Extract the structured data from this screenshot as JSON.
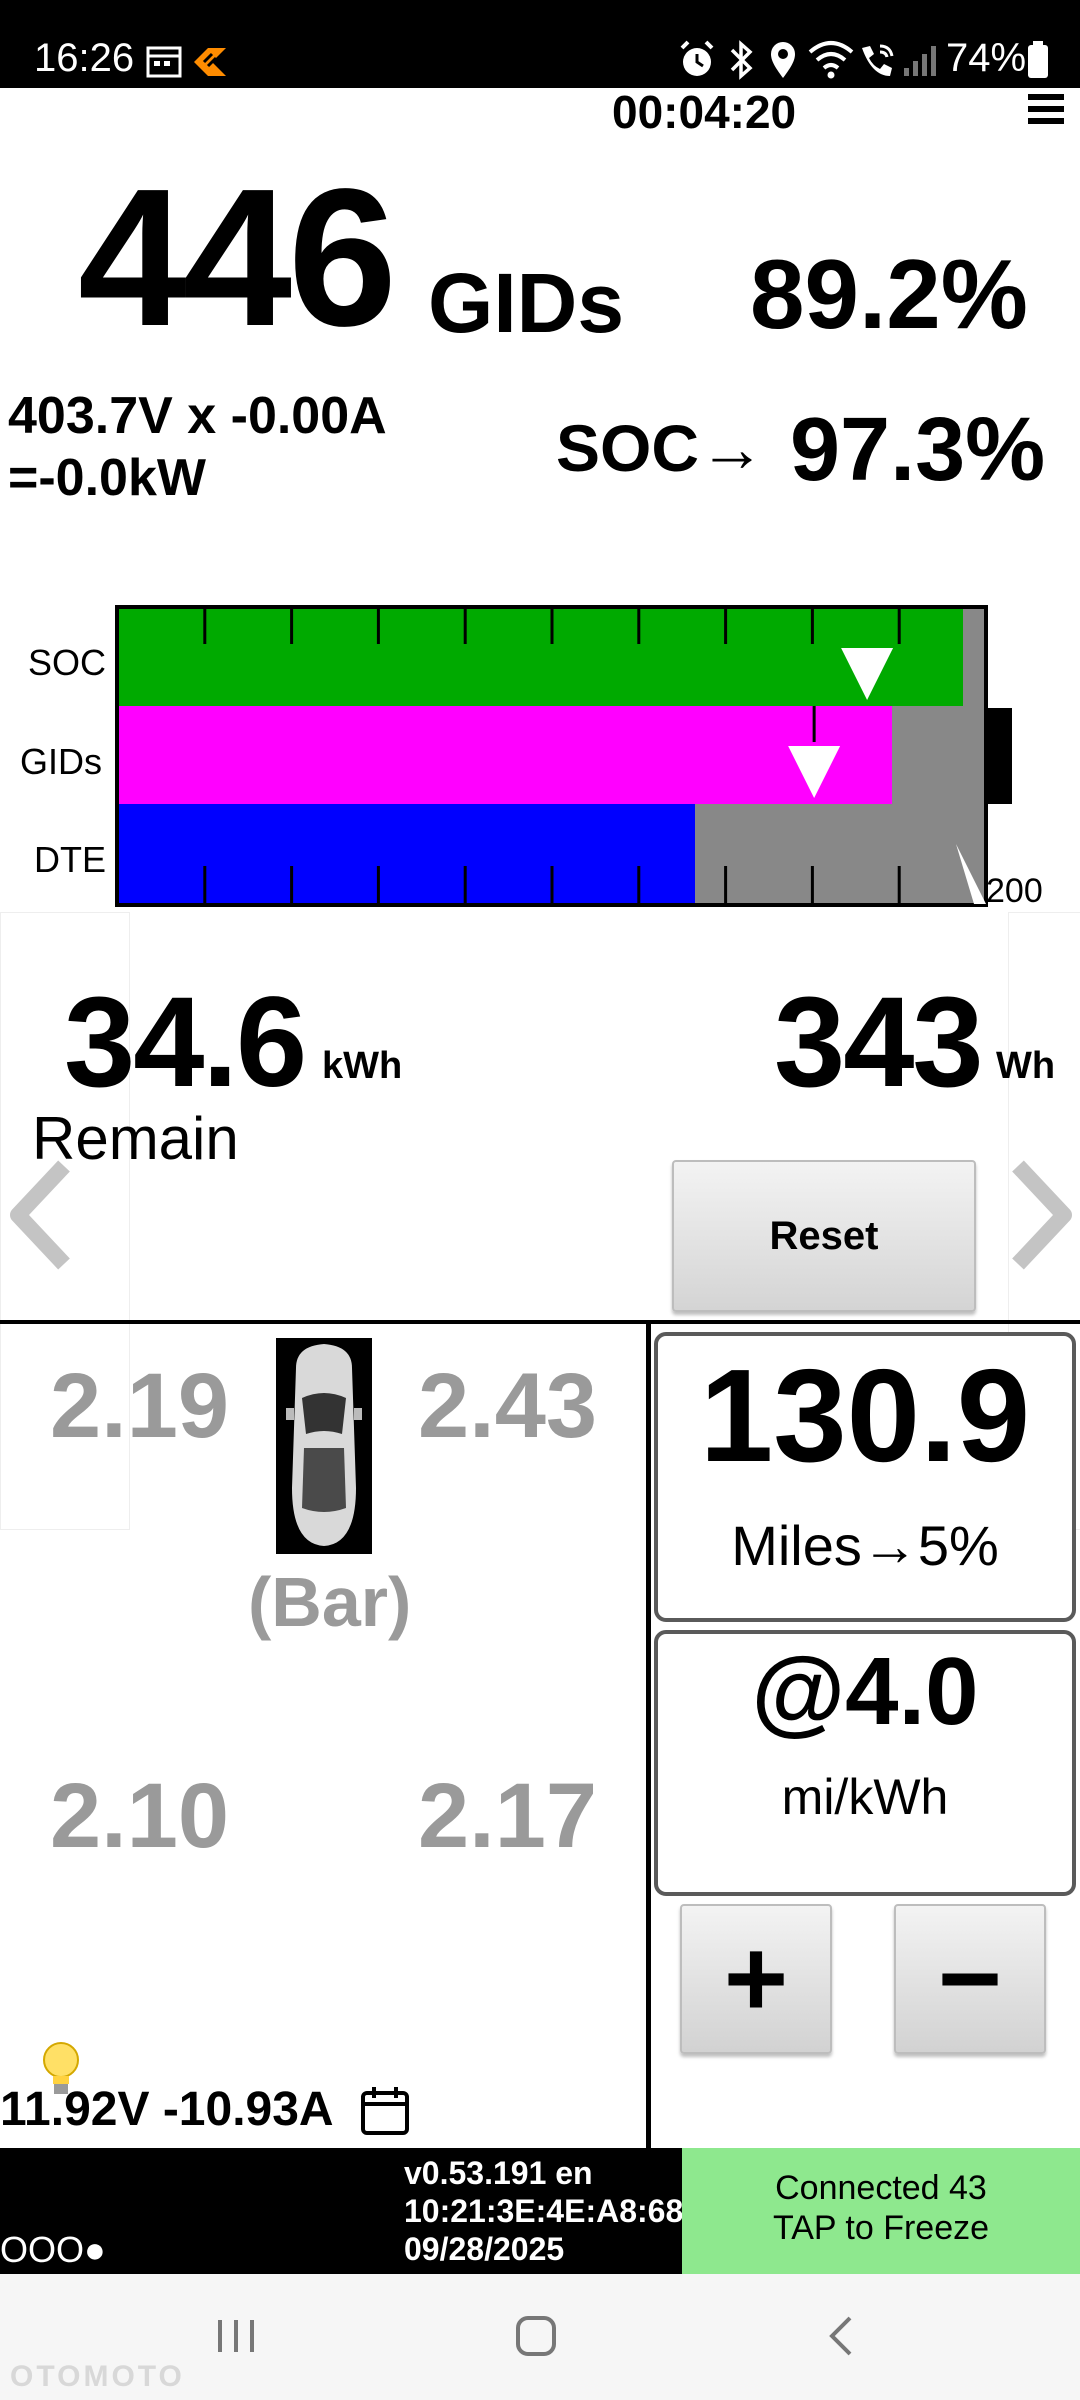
{
  "status_bar": {
    "time": "16:26",
    "battery": "74%",
    "icons": [
      "calendar-icon",
      "app-badge-icon",
      "alarm-icon",
      "bluetooth-icon",
      "location-icon",
      "wifi-icon",
      "wifi-call-icon",
      "signal-icon",
      "battery-icon"
    ]
  },
  "header": {
    "timer": "00:04:20"
  },
  "main": {
    "gids_value": "446",
    "gids_unit": "GIDs",
    "gids_percent": "89.2%",
    "pack_line1": "403.7V x -0.00A",
    "pack_line2": "=-0.0kW",
    "soc_label": "SOC→",
    "soc_percent": "97.3%"
  },
  "bar_chart": {
    "rows": [
      "SOC",
      "GIDs",
      "DTE"
    ],
    "soc_fraction": 0.973,
    "gids_fraction": 0.892,
    "dte_fraction": 0.665,
    "dte_scale_label": "200",
    "colors": {
      "soc": "#00aa00",
      "gids": "#ff00ff",
      "dte": "#0000ff",
      "empty": "#888888",
      "marker": "#ffffff"
    }
  },
  "energy": {
    "kwh_value": "34.6",
    "kwh_unit": "kWh",
    "remain_label": "Remain",
    "wh_value": "343",
    "wh_unit": "Wh",
    "reset_label": "Reset"
  },
  "cells": {
    "front_left": "2.19",
    "front_right": "2.43",
    "rear_left": "2.10",
    "rear_right": "2.17",
    "mode_label": "(Bar)"
  },
  "aux": {
    "battery": "11.92V -10.93A"
  },
  "range": {
    "value": "130.9",
    "unit": "Miles→5%",
    "efficiency_value": "@4.0",
    "efficiency_unit": "mi/kWh",
    "plus_label": "+",
    "minus_label": "−"
  },
  "footer": {
    "dots": "OOO●",
    "version": "v0.53.191 en",
    "mac": "10:21:3E:4E:A8:68",
    "date": "09/28/2025",
    "connect_line1": "Connected 43",
    "connect_line2": "TAP to Freeze",
    "connect_color": "#8ee88e"
  },
  "watermark": "OTOMOTO"
}
